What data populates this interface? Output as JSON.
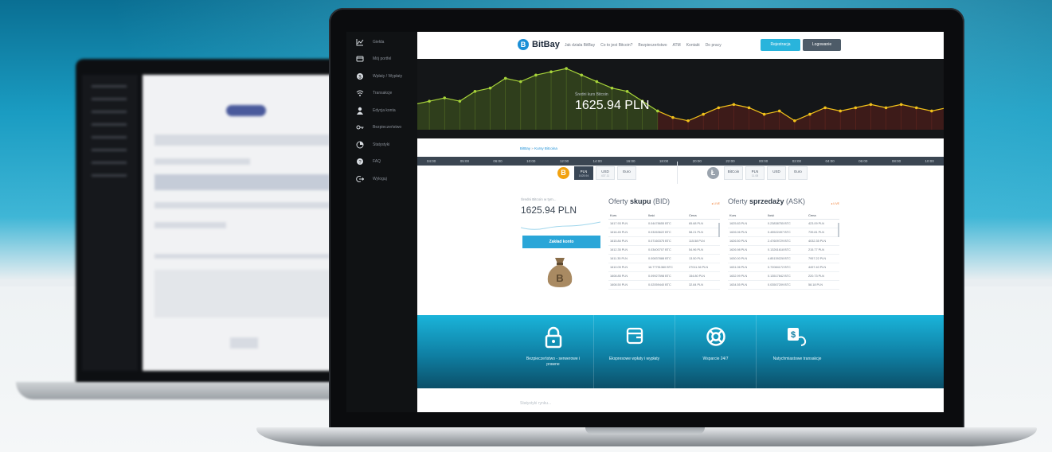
{
  "sidebar": {
    "items": [
      {
        "icon": "chart-icon",
        "label": "Giełda"
      },
      {
        "icon": "wallet-icon",
        "label": "Mój portfel"
      },
      {
        "icon": "deposit-icon",
        "label": "Wpłaty / Wypłaty"
      },
      {
        "icon": "transactions-icon",
        "label": "Transakcje"
      },
      {
        "icon": "user-icon",
        "label": "Edycja konta"
      },
      {
        "icon": "key-icon",
        "label": "Bezpieczeństwo"
      },
      {
        "icon": "stats-icon",
        "label": "Statystyki"
      },
      {
        "icon": "help-icon",
        "label": "FAQ"
      },
      {
        "icon": "logout-icon",
        "label": "Wyloguj"
      }
    ]
  },
  "header": {
    "brand": "BitBay",
    "nav": [
      "Jak działa BitBay",
      "Co to jest Bitcoin?",
      "Bezpieczeństwo",
      "ATM",
      "Kontakt",
      "Do pracy"
    ],
    "register_label": "Rejestracja",
    "login_label": "Logowanie"
  },
  "chart": {
    "caption": "Średni kurs Bitcoin",
    "price": "1625.94 PLN",
    "time_labels": [
      "04:00",
      "05:00",
      "06:00",
      "10:00",
      "12:00",
      "14:00",
      "16:00",
      "18:00",
      "20:00",
      "22:00",
      "00:00",
      "02:00",
      "04:00",
      "06:00",
      "08:00",
      "10:00"
    ],
    "colors": {
      "up": "#a7d43a",
      "down": "#f2c21a"
    }
  },
  "chart_data": {
    "type": "line",
    "y": [
      1612,
      1613,
      1614,
      1613,
      1616,
      1617,
      1620,
      1619,
      1621,
      1622,
      1623,
      1621,
      1619,
      1617,
      1616,
      1613,
      1610,
      1608,
      1607,
      1609,
      1611,
      1612,
      1611,
      1609,
      1610,
      1607,
      1609,
      1611,
      1610,
      1611,
      1612,
      1611,
      1612,
      1611,
      1610,
      1611
    ]
  },
  "breadcrumb": {
    "home": "BitBay",
    "sep": "»",
    "current": "Kursy Bitcoina"
  },
  "currencies_btc": [
    {
      "code": "PLN",
      "value": "1625.94",
      "active": true
    },
    {
      "code": "USD",
      "value": "437.11",
      "active": false
    },
    {
      "code": "Euro",
      "value": "",
      "active": false
    }
  ],
  "currencies_ltc": [
    {
      "code": "BitCoin",
      "value": "",
      "active": false
    },
    {
      "code": "PLN",
      "value": "11.08",
      "active": false
    },
    {
      "code": "USD",
      "value": "",
      "active": false
    },
    {
      "code": "Euro",
      "value": "",
      "active": false
    }
  ],
  "avg": {
    "label": "Średni Bitcoin w tym...",
    "price": "1625.94 PLN",
    "exchange_label": "Zakład konto"
  },
  "bid": {
    "title_prefix": "Oferty ",
    "title_bold": "skupu",
    "title_suffix": " (BID)",
    "live": "● LIVE",
    "headers": [
      "Kurs",
      "Ilość",
      "Cena"
    ],
    "rows": [
      [
        "1617.93 PLN",
        "0.04478655 BTC",
        "65.68 PLN"
      ],
      [
        "1616.45 PLN",
        "0.03263622 BTC",
        "58.21 PLN"
      ],
      [
        "1615.84 PLN",
        "0.07160375 BTC",
        "115.58 PLN"
      ],
      [
        "1612.35 PLN",
        "0.03400707 BTC",
        "54.96 PLN"
      ],
      [
        "1611.35 PLN",
        "0.00837888 BTC",
        "13.50 PLN"
      ],
      [
        "1610.05 PLN",
        "16.77751360 BTC",
        "27011.36 PLN"
      ],
      [
        "1608.85 PLN",
        "0.09927598 BTC",
        "154.80 PLN"
      ],
      [
        "1608.50 PLN",
        "0.02059440 BTC",
        "32.84 PLN"
      ]
    ]
  },
  "ask": {
    "title_prefix": "Oferty ",
    "title_bold": "sprzedaży",
    "title_suffix": " (ASK)",
    "live": "● LIVE",
    "headers": [
      "Kurs",
      "Ilość",
      "Cena"
    ],
    "rows": [
      [
        "1625.83 PLN",
        "0.23838755 BTC",
        "423.09 PLN"
      ],
      [
        "1626.06 PLN",
        "0.45522497 BTC",
        "739.81 PLN"
      ],
      [
        "1626.50 PLN",
        "2.47609729 BTC",
        "4032.35 PLN"
      ],
      [
        "1626.98 PLN",
        "0.13261618 BTC",
        "215.77 PLN"
      ],
      [
        "1630.00 PLN",
        "4.85139228 BTC",
        "7957.22 PLN"
      ],
      [
        "1631.06 PLN",
        "0.72084172 BTC",
        "4497.40 PLN"
      ],
      [
        "1632.99 PLN",
        "0.13517842 BTC",
        "220.73 PLN"
      ],
      [
        "1634.55 PLN",
        "0.03507209 BTC",
        "58.18 PLN"
      ]
    ]
  },
  "features": [
    {
      "icon": "lock-icon",
      "label": "Bezpieczeństwo - serwerowe i prawne"
    },
    {
      "icon": "card-icon",
      "label": "Ekspresowe wpłaty i wypłaty"
    },
    {
      "icon": "lifebuoy-icon",
      "label": "Wsparcie 24/7"
    },
    {
      "icon": "instant-transfer-icon",
      "label": "Natychmiastowe transakcje"
    }
  ],
  "footer": {
    "teaser": "Statystyki rynku..."
  }
}
